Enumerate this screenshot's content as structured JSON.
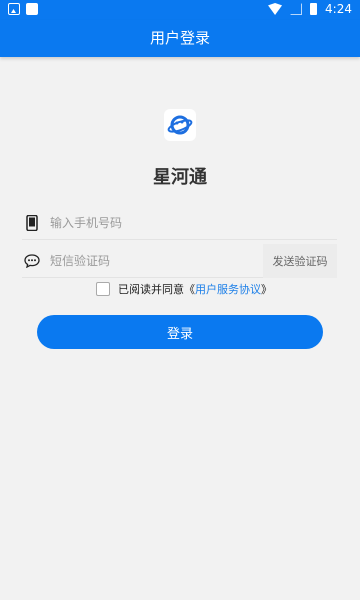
{
  "status_bar": {
    "time": "4:24"
  },
  "header": {
    "title": "用户登录"
  },
  "brand": {
    "name": "星河通"
  },
  "form": {
    "phone_placeholder": "输入手机号码",
    "code_placeholder": "短信验证码",
    "send_code_label": "发送验证码"
  },
  "agreement": {
    "prefix": "已阅读并同意",
    "open_quote": "《",
    "link_text": "用户服务协议",
    "close_quote": "》"
  },
  "login": {
    "label": "登录"
  },
  "colors": {
    "primary": "#0a79f0",
    "link": "#1c7fe8"
  }
}
